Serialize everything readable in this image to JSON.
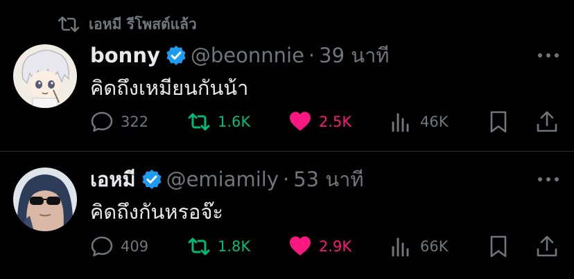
{
  "repost_banner": {
    "text": "เอหมี รีโพสต์แล้ว",
    "icon": "repost-icon"
  },
  "tweets": [
    {
      "name": "bonny",
      "handle": "@beonnnie",
      "separator": "·",
      "time": "39 นาที",
      "text": "คิดถึงเหมียนกันน้า",
      "verified": true,
      "stats": {
        "replies": "322",
        "reposts": "1.6K",
        "likes": "2.5K",
        "views": "46K"
      },
      "reposted_by_me": true,
      "liked_by_me": true
    },
    {
      "name": "เอหมี",
      "handle": "@emiamily",
      "separator": "·",
      "time": "53 นาที",
      "text": "คิดถึงกันหรอจ๊ะ",
      "verified": true,
      "stats": {
        "replies": "409",
        "reposts": "1.8K",
        "likes": "2.9K",
        "views": "66K"
      },
      "reposted_by_me": true,
      "liked_by_me": true
    }
  ],
  "colors": {
    "background": "#000000",
    "primary_text": "#e7e9ea",
    "secondary_text": "#71767b",
    "verified_blue": "#1d9bf0",
    "repost_green": "#00ba7c",
    "like_pink": "#f91880",
    "divider": "#2f3336"
  }
}
